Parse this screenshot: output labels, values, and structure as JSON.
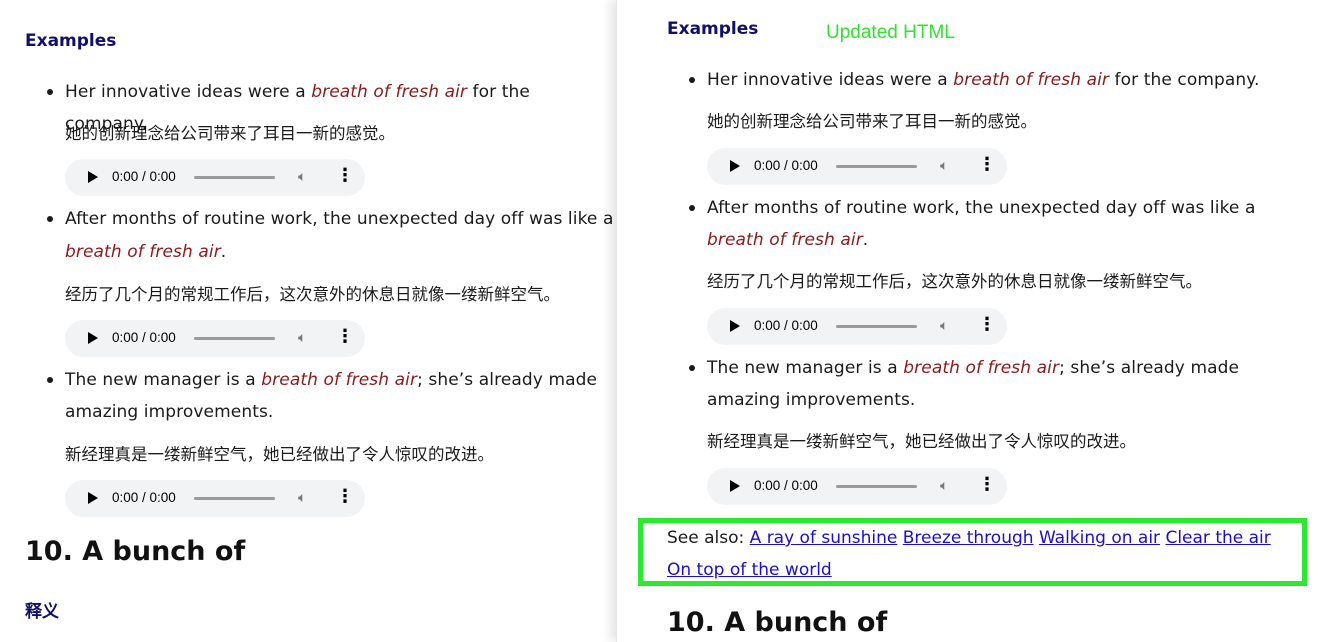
{
  "left_pane": {
    "section_heading": "Examples",
    "examples": [
      {
        "before": "Her innovative ideas were a ",
        "phrase": "breath of fresh air",
        "after": " for the company.",
        "translation": "她的创新理念给公司带来了耳目一新的感觉。",
        "audio_time": "0:00 / 0:00"
      },
      {
        "before": "After months of routine work, the unexpected day off was like a",
        "phrase": "breath of fresh air",
        "after": ".",
        "translation": "经历了几个月的常规工作后，这次意外的休息日就像一缕新鲜空气。",
        "audio_time": "0:00 / 0:00"
      },
      {
        "before": "The new manager is a ",
        "phrase": "breath of fresh air",
        "after": "; she’s already made",
        "after2": "amazing improvements.",
        "translation": "新经理真是一缕新鲜空气，她已经做出了令人惊叹的改进。",
        "audio_time": "0:00 / 0:00"
      }
    ],
    "next_heading": "10. A bunch of",
    "subheading": "释义"
  },
  "right_pane": {
    "section_heading": "Examples",
    "updated_label": "Updated HTML",
    "examples": [
      {
        "before": "Her innovative ideas were a ",
        "phrase": "breath of fresh air",
        "after": " for the company.",
        "translation": "她的创新理念给公司带来了耳目一新的感觉。",
        "audio_time": "0:00 / 0:00"
      },
      {
        "before": "After months of routine work, the unexpected day off was like a",
        "phrase": "breath of fresh air",
        "after": ".",
        "translation": "经历了几个月的常规工作后，这次意外的休息日就像一缕新鲜空气。",
        "audio_time": "0:00 / 0:00"
      },
      {
        "before": "The new manager is a ",
        "phrase": "breath of fresh air",
        "after": "; she’s already made",
        "after2": "amazing improvements.",
        "translation": "新经理真是一缕新鲜空气，她已经做出了令人惊叹的改进。",
        "audio_time": "0:00 / 0:00"
      }
    ],
    "see_also": {
      "label": "See also: ",
      "links": [
        "A ray of sunshine",
        "Breeze through",
        "Walking on air",
        "Clear the air",
        "On top of the world"
      ]
    },
    "next_heading": "10. A bunch of"
  },
  "colors": {
    "heading": "#10106b",
    "phrase": "#8b1a1a",
    "link": "#1a0fcc",
    "highlight_border": "#2ee82e",
    "updated_label": "#2fe32f"
  },
  "icons": [
    "play-icon",
    "volume-icon",
    "more-options-icon"
  ]
}
